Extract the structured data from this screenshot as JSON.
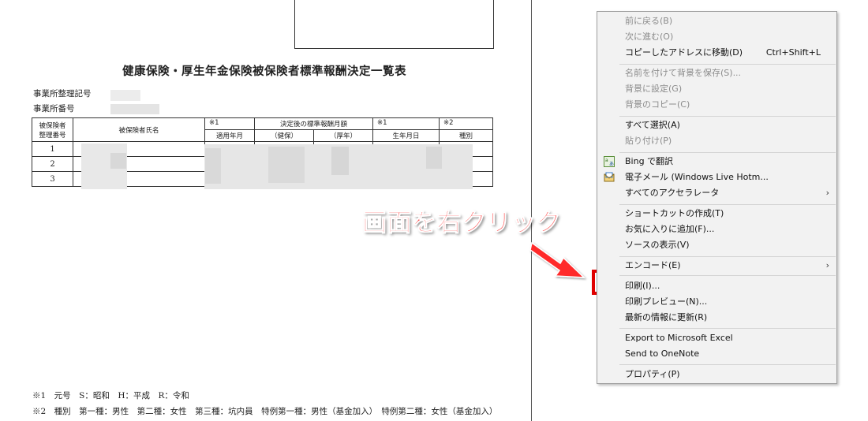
{
  "document": {
    "title": "健康保険・厚生年金保険被保険者標準報酬決定一覧表",
    "office_code_label": "事業所整理記号",
    "office_number_label": "事業所番号",
    "table": {
      "headers": {
        "insured_no": "被保険者",
        "insured_no_2": "整理番号",
        "insured_name": "被保険者氏名",
        "note1": "※1",
        "apply_month": "適用年月",
        "decided_amount": "決定後の標準報酬月額",
        "health": "（健保）",
        "pension": "（厚年）",
        "note1b": "※1",
        "birth_date": "生年月日",
        "note2": "※2",
        "type": "種別"
      },
      "rows": [
        "1",
        "2",
        "3"
      ]
    },
    "footer": {
      "line1": "※1　元号　S：昭和　H：平成　R：令和",
      "line2": "※2　種別　第一種：男性　第二種：女性　第三種：坑内員　特例第一種：男性（基金加入）　特例第二種：女性（基金加入）"
    }
  },
  "annotation": {
    "text": "画面を右クリック",
    "color": "#ff3a3a",
    "highlight_color": "#e00000"
  },
  "context_menu": {
    "items": [
      {
        "label": "前に戻る(B)",
        "disabled": true
      },
      {
        "label": "次に進む(O)",
        "disabled": true
      },
      {
        "label": "コピーしたアドレスに移動(D)",
        "shortcut": "Ctrl+Shift+L"
      },
      {
        "label": "名前を付けて背景を保存(S)...",
        "disabled": true
      },
      {
        "label": "背景に設定(G)",
        "disabled": true
      },
      {
        "label": "背景のコピー(C)",
        "disabled": true
      },
      {
        "label": "すべて選択(A)"
      },
      {
        "label": "貼り付け(P)",
        "disabled": true
      },
      {
        "label": "Bing で翻訳",
        "icon": "bing-translate-icon"
      },
      {
        "label": "電子メール (Windows Live Hotm...",
        "icon": "email-icon"
      },
      {
        "label": "すべてのアクセラレータ",
        "submenu": "›"
      },
      {
        "label": "ショートカットの作成(T)"
      },
      {
        "label": "お気に入りに追加(F)..."
      },
      {
        "label": "ソースの表示(V)"
      },
      {
        "label": "エンコード(E)",
        "submenu": "›"
      },
      {
        "label": "印刷(I)..."
      },
      {
        "label": "印刷プレビュー(N)..."
      },
      {
        "label": "最新の情報に更新(R)"
      },
      {
        "label": "Export to Microsoft Excel"
      },
      {
        "label": "Send to OneNote"
      },
      {
        "label": "プロパティ(P)"
      }
    ]
  }
}
